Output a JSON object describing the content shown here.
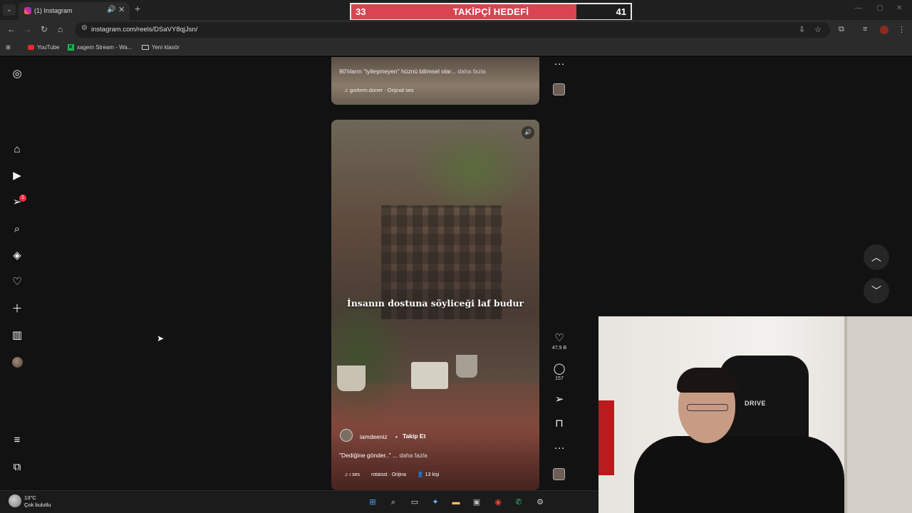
{
  "browser": {
    "tab_title": "(1) Instagram",
    "url": "instagram.com/reels/DSaVY8qjJsn/",
    "bookmarks": [
      {
        "label": "YouTube"
      },
      {
        "label": "xagem Stream - Wa..."
      },
      {
        "label": "Yeni klasör"
      }
    ]
  },
  "goal_widget": {
    "current": "33",
    "label": "TAKİPÇİ HEDEFİ",
    "target": "41",
    "progress_fraction": 0.805
  },
  "sidebar": {
    "notification_count": "1",
    "icons": [
      "instagram-icon",
      "home-icon",
      "reels-icon",
      "messages-icon",
      "search-icon",
      "explore-icon",
      "notifications-icon",
      "create-icon",
      "dashboard-icon",
      "profile-avatar",
      "menu-icon",
      "more-icon"
    ]
  },
  "previous_reel": {
    "caption": "90'lıların \"iyileşmeyen\" hüznü bilimsel olar...",
    "more": "daha fazla",
    "audio": "gorkem.doner · Orijinal ses"
  },
  "reel": {
    "overlay_text": "İnsanın dostuna söyliceği laf budur",
    "username": "iamdeeniz",
    "dot": "•",
    "follow_label": "Takip Et",
    "caption": "\"Dediğine gönder..\" ...",
    "more": "daha fazla",
    "audio_sounds": "ı ses",
    "audio_source": "rotaisst · Orijina",
    "people": "13 kişi",
    "likes": "47,9 B",
    "comments": "157"
  },
  "taskbar": {
    "temperature": "13°C",
    "condition": "Çok bulutlu"
  },
  "webcam": {
    "chair_logo": "DRIVE"
  }
}
